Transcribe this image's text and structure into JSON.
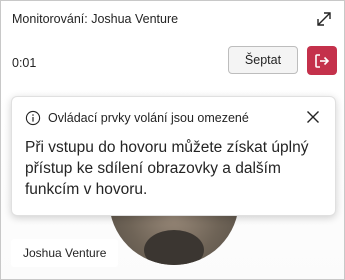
{
  "window": {
    "title": "Monitorování: Joshua Venture"
  },
  "toolbar": {
    "timer": "0:01",
    "whisper_label": "Šeptat"
  },
  "participant": {
    "name": "Joshua Venture"
  },
  "notice": {
    "title": "Ovládací prvky volání jsou omezené",
    "body": "Při vstupu do hovoru můžete získat úplný přístup ke sdílení obrazovky a dalším funkcím v hovoru."
  },
  "colors": {
    "leave_button": "#c4314b"
  },
  "icons": {
    "expand": "expand-icon",
    "leave": "leave-icon",
    "info": "info-icon",
    "close": "close-icon"
  }
}
